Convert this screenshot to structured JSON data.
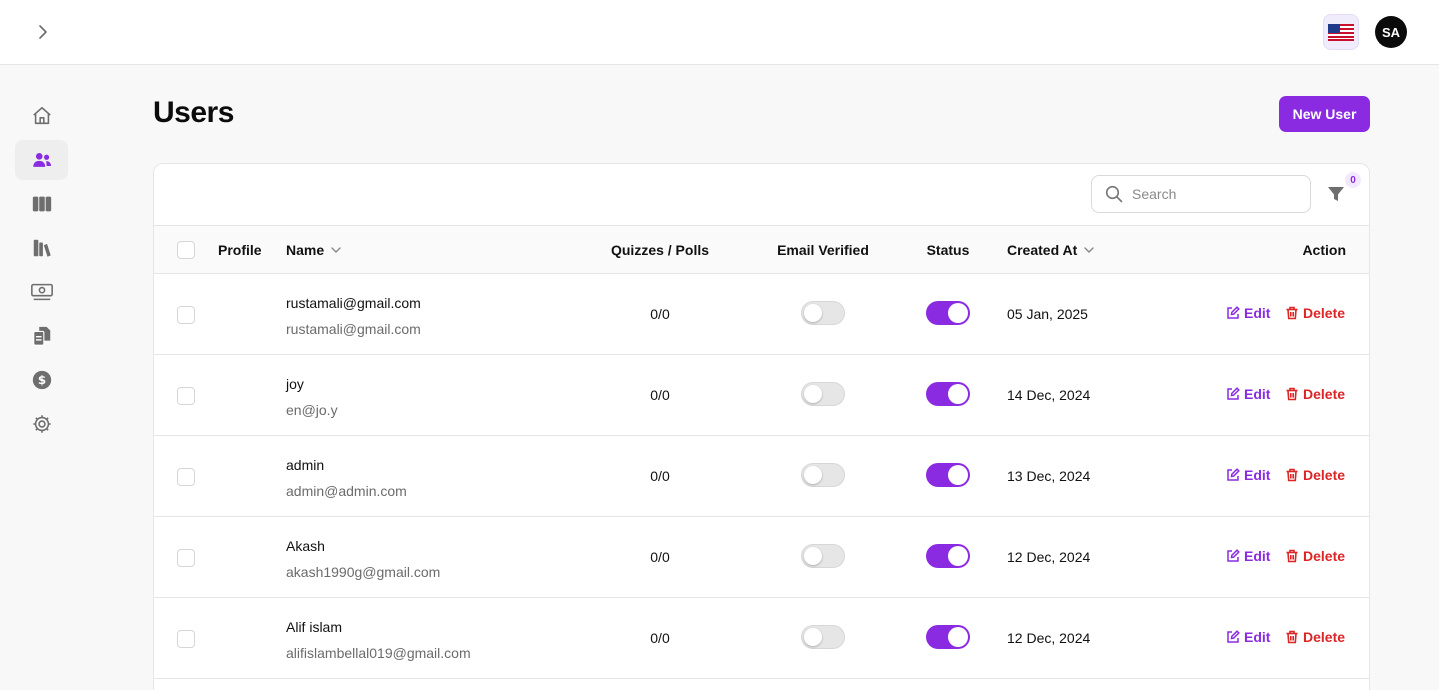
{
  "header": {
    "avatar_initials": "SA",
    "expand_icon": "chevron-right-icon",
    "language_icon": "us-flag-icon"
  },
  "sidebar": {
    "items": [
      {
        "icon": "home-icon",
        "active": false
      },
      {
        "icon": "users-icon",
        "active": true
      },
      {
        "icon": "columns-icon",
        "active": false
      },
      {
        "icon": "books-icon",
        "active": false
      },
      {
        "icon": "money-icon",
        "active": false
      },
      {
        "icon": "documents-icon",
        "active": false
      },
      {
        "icon": "dollar-icon",
        "active": false
      },
      {
        "icon": "gear-icon",
        "active": false
      }
    ]
  },
  "page": {
    "title": "Users",
    "new_user_label": "New User"
  },
  "toolbar": {
    "search_placeholder": "Search",
    "search_value": "",
    "filter_count": "0"
  },
  "table": {
    "columns": {
      "profile": "Profile",
      "name": "Name",
      "quizzes_polls": "Quizzes / Polls",
      "email_verified": "Email Verified",
      "status": "Status",
      "created_at": "Created At",
      "action": "Action"
    },
    "edit_label": "Edit",
    "delete_label": "Delete",
    "rows": [
      {
        "name": "rustamali@gmail.com",
        "email": "rustamali@gmail.com",
        "quizzes_polls": "0/0",
        "email_verified": false,
        "status": true,
        "created_at": "05 Jan, 2025"
      },
      {
        "name": "joy",
        "email": "en@jo.y",
        "quizzes_polls": "0/0",
        "email_verified": false,
        "status": true,
        "created_at": "14 Dec, 2024"
      },
      {
        "name": "admin",
        "email": "admin@admin.com",
        "quizzes_polls": "0/0",
        "email_verified": false,
        "status": true,
        "created_at": "13 Dec, 2024"
      },
      {
        "name": "Akash",
        "email": "akash1990g@gmail.com",
        "quizzes_polls": "0/0",
        "email_verified": false,
        "status": true,
        "created_at": "12 Dec, 2024"
      },
      {
        "name": "Alif islam",
        "email": "alifislambellal019@gmail.com",
        "quizzes_polls": "0/0",
        "email_verified": false,
        "status": true,
        "created_at": "12 Dec, 2024"
      }
    ]
  },
  "colors": {
    "accent": "#8a2be2",
    "danger": "#dc2626"
  }
}
